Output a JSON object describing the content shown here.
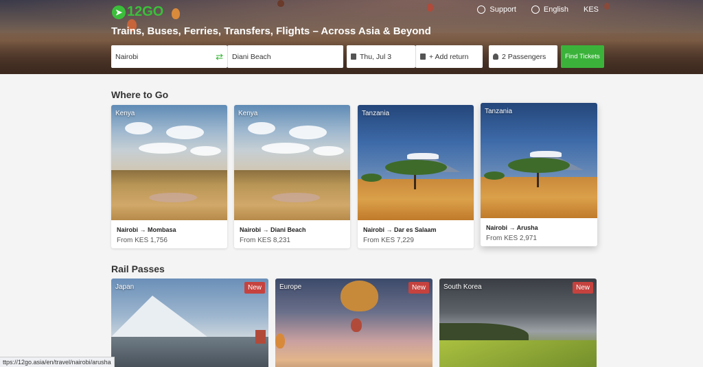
{
  "brand": {
    "logo_text": "12GO",
    "accent": "#3bbf3b"
  },
  "topnav": {
    "support": "Support",
    "language": "English",
    "currency": "KES"
  },
  "hero": {
    "title": "Trains, Buses, Ferries, Transfers, Flights – Across Asia & Beyond"
  },
  "search": {
    "from": "Nairobi",
    "to": "Diani Beach",
    "date": "Thu, Jul 3",
    "return": "+ Add return",
    "passengers": "2 Passengers",
    "button": "Find Tickets"
  },
  "where_to_go": {
    "title": "Where to Go",
    "cards": [
      {
        "country": "Kenya",
        "route": "Nairobi → Mombasa",
        "price": "From KES 1,756"
      },
      {
        "country": "Kenya",
        "route": "Nairobi → Diani Beach",
        "price": "From KES 8,231"
      },
      {
        "country": "Tanzania",
        "route": "Nairobi → Dar es Salaam",
        "price": "From KES 7,229"
      },
      {
        "country": "Tanzania",
        "route": "Nairobi → Arusha",
        "price": "From KES 2,971"
      }
    ]
  },
  "rail_passes": {
    "title": "Rail Passes",
    "cards": [
      {
        "country": "Japan",
        "badge": "New"
      },
      {
        "country": "Europe",
        "badge": "New"
      },
      {
        "country": "South Korea",
        "badge": "New"
      }
    ]
  },
  "status_bar": {
    "url": "ttps://12go.asia/en/travel/nairobi/arusha"
  }
}
